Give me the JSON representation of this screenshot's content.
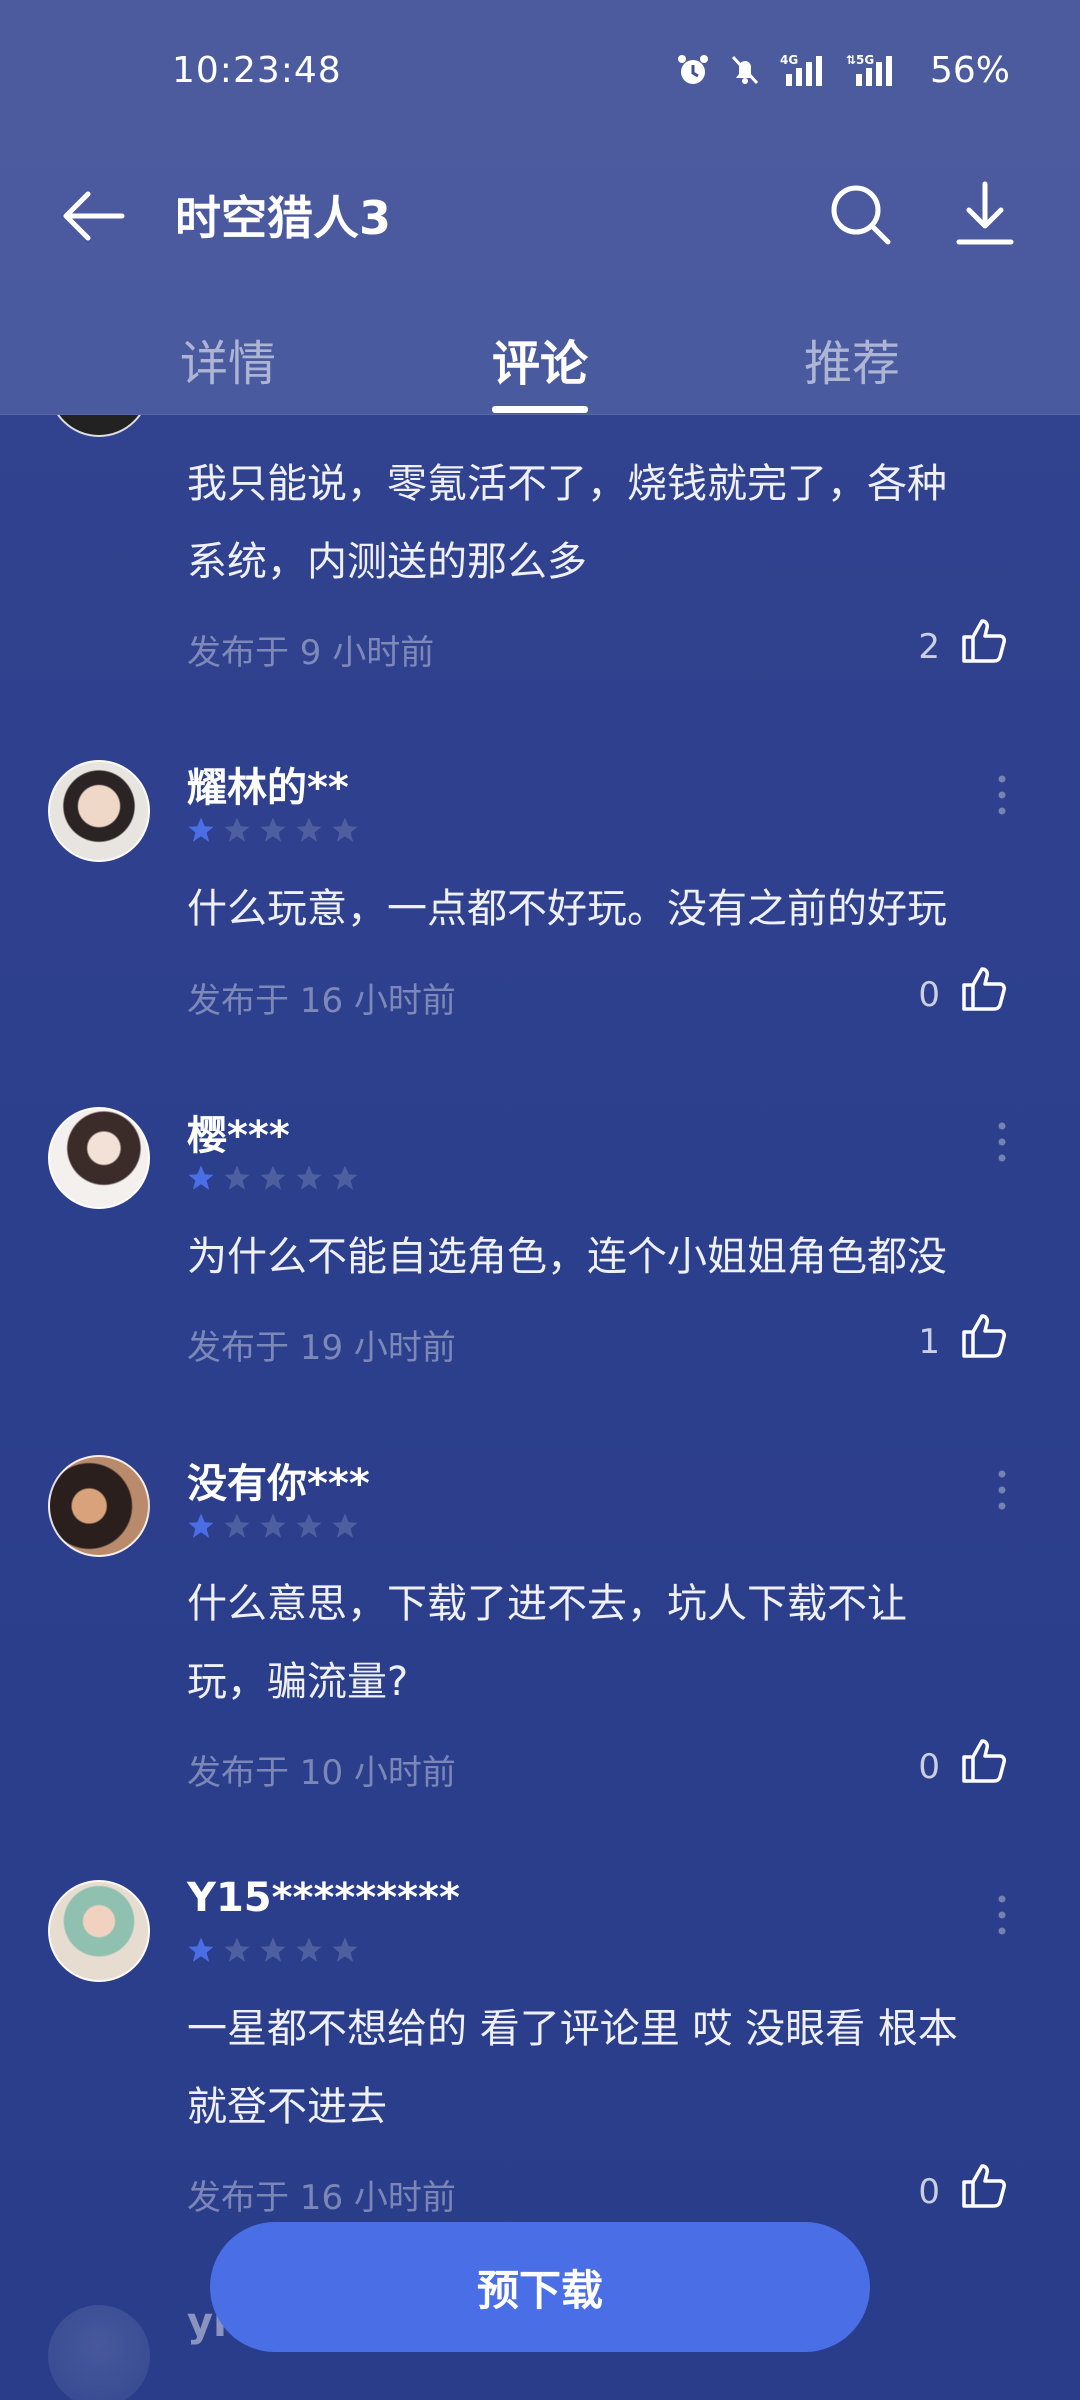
{
  "status_bar": {
    "time": "10:23:48",
    "battery": "56%",
    "icons": [
      "alarm-icon",
      "mute-bell-icon",
      "signal-4g-icon",
      "signal-5g-icon"
    ]
  },
  "app_bar": {
    "title": "时空猎人3"
  },
  "tabs": [
    {
      "label": "详情",
      "active": false
    },
    {
      "label": "评论",
      "active": true
    },
    {
      "label": "推荐",
      "active": false
    }
  ],
  "colors": {
    "background": "#2c3f8d",
    "header": "#4a5a9f",
    "accent": "#4a6ee6",
    "star_filled": "#4a6ee6",
    "star_empty": "#4e5f9f"
  },
  "reviews": [
    {
      "text": "我只能说，零氪活不了，烧钱就完了，各种系统，内测送的那么多",
      "text_lines": [
        "我只能说，零氪活不了，烧钱就完了，各种",
        "系统，内测送的那么多"
      ],
      "posted": "发布于 9 小时前",
      "likes": "2"
    },
    {
      "username": "耀林的**",
      "rating": 1,
      "text": "什么玩意，一点都不好玩。没有之前的好玩",
      "posted": "发布于 16 小时前",
      "likes": "0"
    },
    {
      "username": "樱***",
      "rating": 1,
      "text": "为什么不能自选角色，连个小姐姐角色都没",
      "posted": "发布于 19 小时前",
      "likes": "1"
    },
    {
      "username": "没有你***",
      "rating": 1,
      "text_lines": [
        "什么意思，下载了进不去，坑人下载不让",
        "玩，骗流量?"
      ],
      "posted": "发布于 10 小时前",
      "likes": "0"
    },
    {
      "username": "Y15*********",
      "rating": 1,
      "text_lines": [
        "一星都不想给的 看了评论里 哎 没眼看 根本",
        "就登不进去"
      ],
      "posted": "发布于 16 小时前",
      "likes": "0"
    },
    {
      "username": "yi"
    }
  ],
  "primary_button": {
    "label": "预下载"
  }
}
